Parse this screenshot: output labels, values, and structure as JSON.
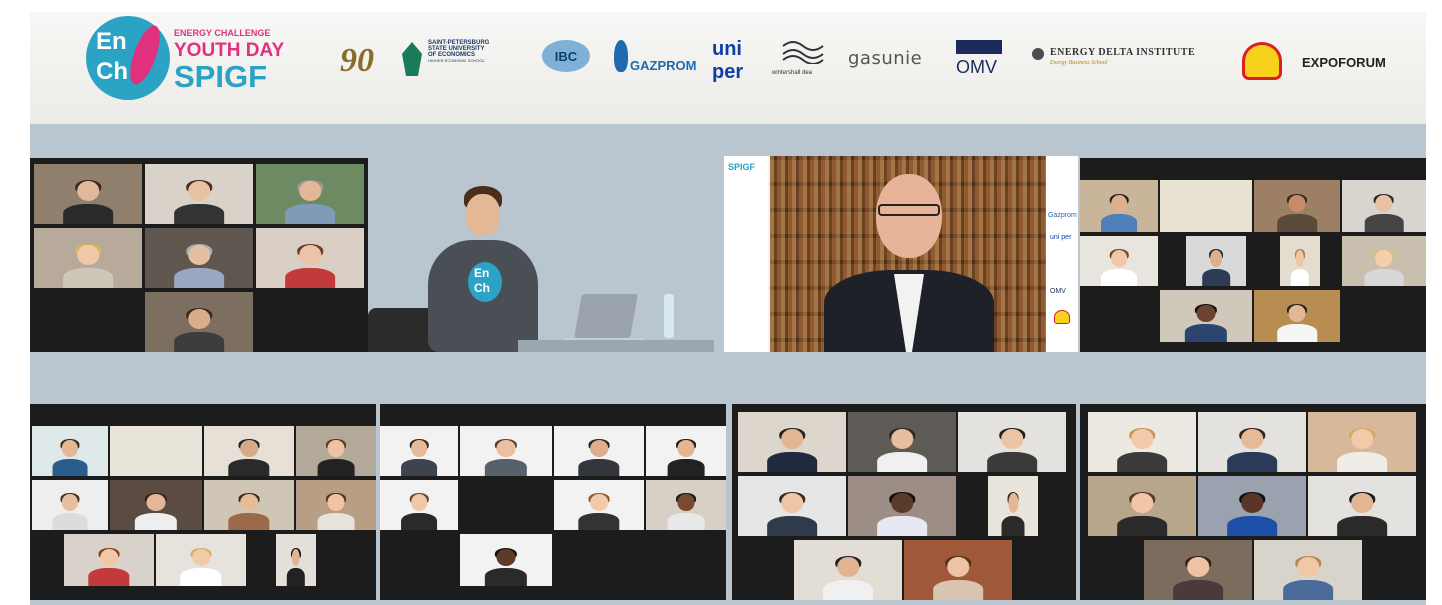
{
  "banner": {
    "logo": {
      "en": "En",
      "ch": "Ch",
      "line1": "ENERGY CHALLENGE",
      "line2": "YOUTH DAY",
      "line3": "SPIGF"
    },
    "sponsors": {
      "anniversary": "90",
      "unecon": [
        "SAINT-PETERSBURG",
        "STATE UNIVERSITY",
        "OF ECONOMICS",
        "HIGHER ECONOMIC SCHOOL"
      ],
      "ibc": "IBC",
      "gazprom": "GAZPROM",
      "uniper_top": "uni",
      "uniper_bottom": "per",
      "wintershall": "wintershall dea",
      "gasunie": "gasunie",
      "omv": "OMV",
      "edi_title": "ENERGY DELTA INSTITUTE",
      "edi_sub": "Energy Business School",
      "expoforum": "EXPOFORUM"
    }
  },
  "presenter": {
    "hoodie_top": "En",
    "hoodie_bottom": "Ch"
  },
  "speaker_slide": {
    "label": "SPIGF",
    "side_labels": [
      "Gazprom",
      "uni per",
      "OMV"
    ]
  },
  "colors": {
    "enchTeal": "#2aa3c4",
    "enchPink": "#e0317e",
    "gazpromBlue": "#1f6ab0",
    "uniperBlue": "#0d3fa6",
    "omvNavy": "#1b2c5c",
    "shellYellow": "#f8d11c",
    "shellRed": "#dd1d21",
    "backdrop": "#b9c6cf"
  }
}
